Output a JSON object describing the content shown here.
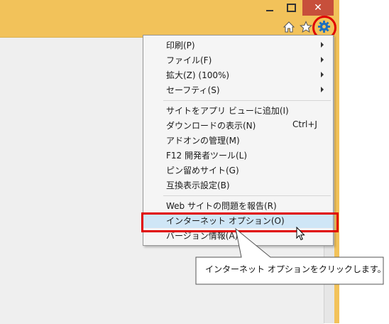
{
  "window": {
    "buttons": {
      "close": "✕"
    }
  },
  "toolbar": {
    "icons": [
      "home-icon",
      "star-icon",
      "gear-icon"
    ]
  },
  "menu": {
    "items": [
      {
        "label": "印刷(P)",
        "submenu": true
      },
      {
        "label": "ファイル(F)",
        "submenu": true
      },
      {
        "label": "拡大(Z) (100%)",
        "submenu": true
      },
      {
        "label": "セーフティ(S)",
        "submenu": true
      },
      {
        "label": "サイトをアプリ ビューに追加(I)"
      },
      {
        "label": "ダウンロードの表示(N)",
        "shortcut": "Ctrl+J"
      },
      {
        "label": "アドオンの管理(M)"
      },
      {
        "label": "F12 開発者ツール(L)"
      },
      {
        "label": "ピン留めサイト(G)"
      },
      {
        "label": "互換表示設定(B)"
      },
      {
        "label": "Web サイトの問題を報告(R)"
      },
      {
        "label": "インターネット オプション(O)",
        "highlighted": true
      },
      {
        "label": "バージョン情報(A)"
      }
    ]
  },
  "callout": {
    "text": "インターネット オプションをクリックします。"
  },
  "colors": {
    "frame": "#f2c25a",
    "close_button": "#c74f3b",
    "highlight_outline": "#e00000",
    "menu_highlight": "#cfe6f6"
  }
}
